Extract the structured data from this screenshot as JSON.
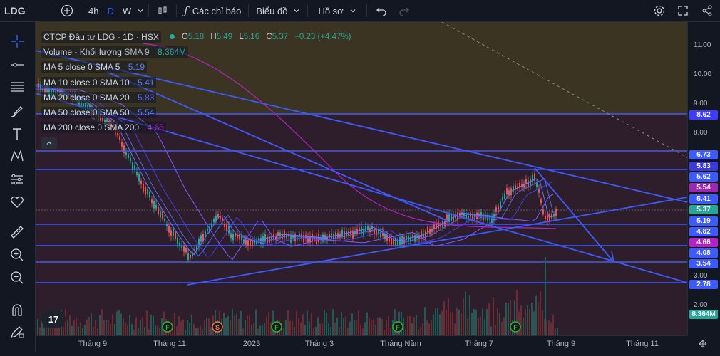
{
  "toolbar": {
    "symbol": "LDG",
    "intervals": [
      "4h",
      "D",
      "W"
    ],
    "selected_interval": "D",
    "indicators_label": "Các chỉ báo",
    "chart_type_label": "Biểu đồ",
    "profile_label": "Hồ sơ"
  },
  "legend": {
    "title": "CTCP Đầu tư LDG · 1D · HSX",
    "ohlc": {
      "o_label": "O",
      "o": "5.18",
      "h_label": "H",
      "h": "5.49",
      "l_label": "L",
      "l": "5.16",
      "c_label": "C",
      "c": "5.37",
      "change": "+0.23 (+4.47%)"
    },
    "indicators": [
      {
        "name": "Volume - Khối lượng",
        "params": "SMA 9",
        "value": "8.364M",
        "color": "#26a69a"
      },
      {
        "name": "MA 5 close 0 SMA 5",
        "params": "",
        "value": "5.19",
        "color": "#5b7cff"
      },
      {
        "name": "MA 10 close 0 SMA 10",
        "params": "",
        "value": "5.41",
        "color": "#5b7cff"
      },
      {
        "name": "MA 20 close 0 SMA 20",
        "params": "",
        "value": "5.83",
        "color": "#5b5bff"
      },
      {
        "name": "MA 50 close 0 SMA 50",
        "params": "",
        "value": "5.54",
        "color": "#5b7cff"
      },
      {
        "name": "MA 200 close 0 SMA 200",
        "params": "",
        "value": "4.66",
        "color": "#c03bd6"
      }
    ],
    "collapse_icon": "chevron-up-icon"
  },
  "price_scale": {
    "ticks": [
      "11.00",
      "10.00",
      "9.00",
      "8.00",
      "2.00"
    ],
    "labels": [
      {
        "text": "8.62",
        "color": "#3d3dff"
      },
      {
        "text": "6.73",
        "color": "#3d5afe"
      },
      {
        "text": "5.83",
        "color": "#3b3bd8"
      },
      {
        "text": "5.62",
        "color": "#3d5afe"
      },
      {
        "text": "5.54",
        "color": "#9c27b0"
      },
      {
        "text": "5.41",
        "color": "#3d5afe"
      },
      {
        "text": "5.37",
        "color": "#26a69a"
      },
      {
        "text": "5.19",
        "color": "#3d5afe"
      },
      {
        "text": "4.82",
        "color": "#3d5afe"
      },
      {
        "text": "4.66",
        "color": "#b321c9"
      },
      {
        "text": "4.08",
        "color": "#3d5afe"
      },
      {
        "text": "3.54",
        "color": "#3d5afe"
      },
      {
        "text": "2.78",
        "color": "#3d5afe"
      },
      {
        "text": "8.364M",
        "color": "#26a69a"
      }
    ]
  },
  "time_scale": [
    "Tháng 9",
    "Tháng 11",
    "2023",
    "Tháng 3",
    "Tháng Năm",
    "Tháng 7",
    "Tháng 9",
    "Tháng 11"
  ],
  "event_markers": [
    "F",
    "S",
    "F",
    "F",
    "F"
  ],
  "colors": {
    "up": "#26a69a",
    "down": "#ef5350",
    "trendline": "#3d5afe",
    "background": "#131722"
  }
}
